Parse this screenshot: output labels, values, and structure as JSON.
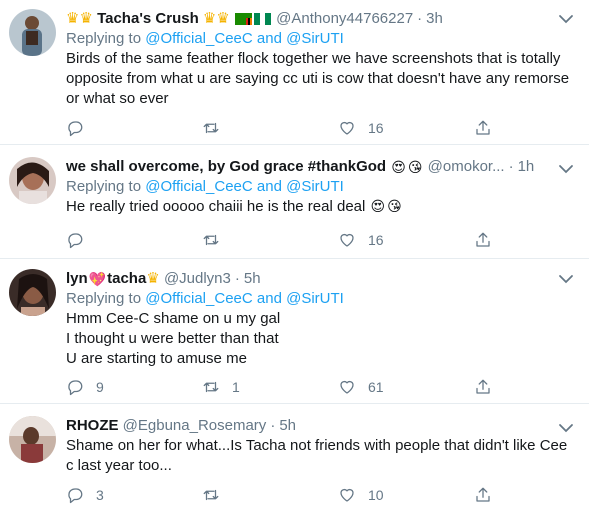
{
  "tweets": [
    {
      "name": "Tacha's Crush",
      "handle": "@Anthony44766227",
      "time": "3h",
      "reply_prefix": "Replying to",
      "reply_user1": "@Official_CeeC",
      "reply_and": "and",
      "reply_user2": "@SirUTI",
      "lines": [
        "Birds of the same feather flock together we have screenshots that is totally",
        "opposite from what u are saying cc uti is cow that doesn't have any remorse",
        "or what so ever"
      ],
      "replies": "",
      "retweets": "",
      "likes": "16"
    },
    {
      "name": "we shall overcome, by God grace #thankGod",
      "handle": "@omokor...",
      "time": "1h",
      "reply_prefix": "Replying to",
      "reply_user1": "@Official_CeeC",
      "reply_and": "and",
      "reply_user2": "@SirUTI",
      "lines": [
        "He really tried ooooo chaiii he is the real deal"
      ],
      "replies": "",
      "retweets": "",
      "likes": "16"
    },
    {
      "name_part1": "lyn",
      "name_part2": "tacha",
      "handle": "@Judlyn3",
      "time": "5h",
      "reply_prefix": "Replying to",
      "reply_user1": "@Official_CeeC",
      "reply_and": "and",
      "reply_user2": "@SirUTI",
      "lines": [
        "Hmm Cee-C shame on u my gal",
        "I thought u were better than that",
        "U are starting to amuse me"
      ],
      "replies": "9",
      "retweets": "1",
      "likes": "61"
    },
    {
      "name": "RHOZE",
      "handle": "@Egbuna_Rosemary",
      "time": "5h",
      "lines": [
        "Shame on her for what...Is Tacha not friends with people that didn't like Cee",
        "c last year too..."
      ],
      "replies": "3",
      "retweets": "",
      "likes": "10"
    }
  ],
  "sep": "·",
  "colors": {
    "link": "#1da1f2",
    "muted": "#657786",
    "text": "#14171a",
    "border": "#e6ecf0"
  },
  "icons": [
    "reply-icon",
    "retweet-icon",
    "like-icon",
    "share-icon",
    "chevron-down-icon",
    "crown-emoji",
    "heart-eyes-emoji",
    "kiss-emoji",
    "heart-emoji",
    "zambia-flag",
    "nigeria-flag"
  ]
}
